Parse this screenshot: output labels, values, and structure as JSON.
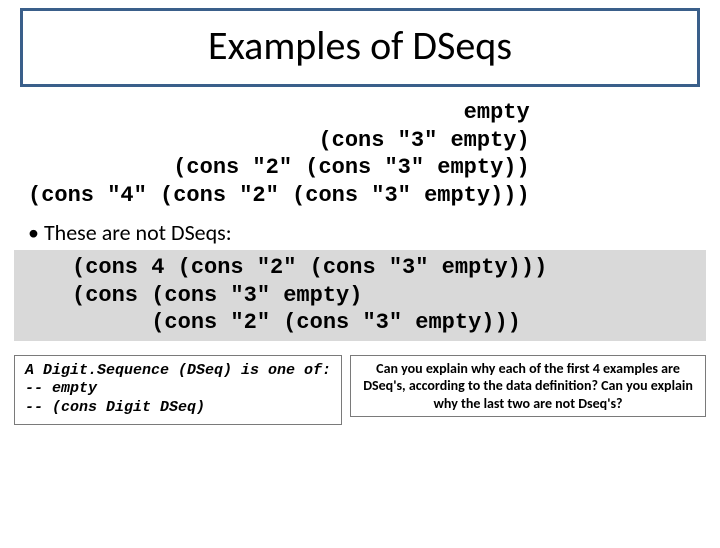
{
  "title": "Examples of DSeqs",
  "examples_good": "                                 empty\n                      (cons \"3\" empty)\n           (cons \"2\" (cons \"3\" empty))\n(cons \"4\" (cons \"2\" (cons \"3\" empty)))",
  "not_label": "These are not DSeqs:",
  "examples_bad": "(cons 4 (cons \"2\" (cons \"3\" empty)))\n(cons (cons \"3\" empty)\n      (cons \"2\" (cons \"3\" empty)))",
  "definition": "A Digit.Sequence (DSeq) is one of:\n-- empty\n-- (cons Digit DSeq)",
  "question": "Can you explain why each of the first 4 examples are DSeq's, according to the data definition?\nCan you explain why the last two are not Dseq's?"
}
